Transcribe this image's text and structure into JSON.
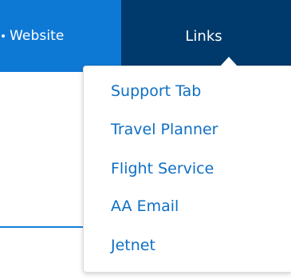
{
  "nav": {
    "website_label": "Website",
    "links_label": "Links"
  },
  "links_menu": {
    "items": [
      {
        "label": "Support Tab"
      },
      {
        "label": "Travel Planner"
      },
      {
        "label": "Flight Service"
      },
      {
        "label": "AA Email"
      },
      {
        "label": "Jetnet"
      }
    ]
  },
  "colors": {
    "website_tab_bg": "#0e78d5",
    "links_tab_bg": "#003a6c",
    "link_text": "#0e6fc4"
  }
}
